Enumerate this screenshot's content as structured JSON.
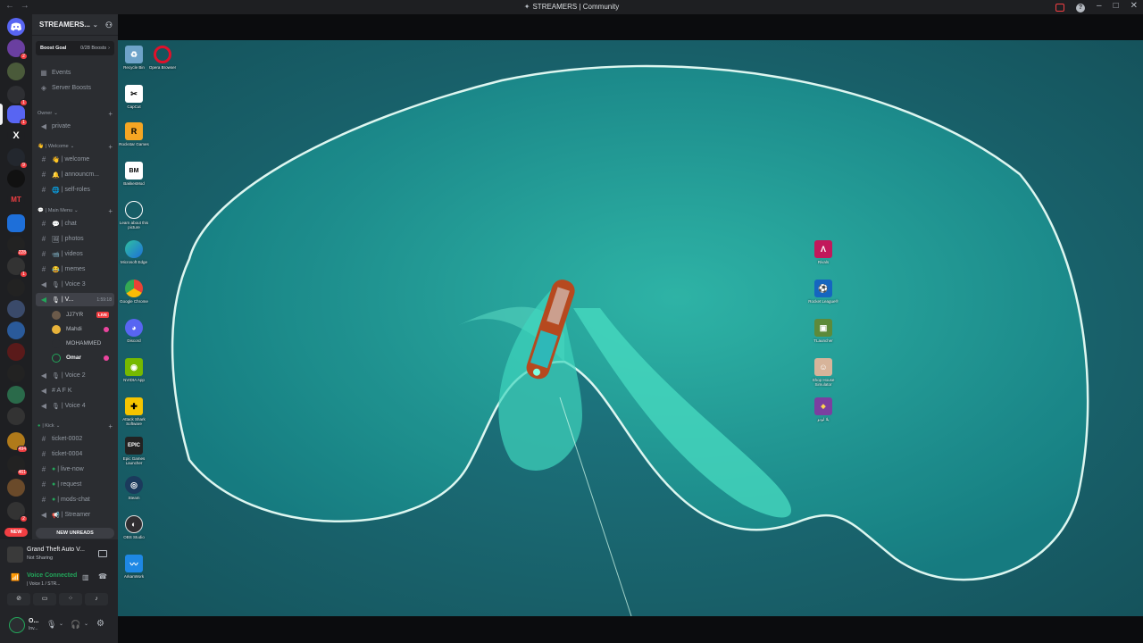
{
  "window": {
    "title": "STREAMERS | Community",
    "back": "←",
    "forward": "→",
    "minimize": "–",
    "maximize": "□",
    "close": "✕"
  },
  "server": {
    "name": "STREAMERS...",
    "boost_goal": "Boost Goal",
    "boost_count": "0/28 Boosts"
  },
  "nav": {
    "events": "Events",
    "server_boosts": "Server Boosts"
  },
  "categories": {
    "owner": "Owner",
    "welcome": "| Welcome",
    "main_menu": "| Main Menu",
    "kick": "| Kick"
  },
  "channels": {
    "private": "private",
    "welcome": "| welcome",
    "announcements": "| announcm...",
    "self_roles": "| self-roles",
    "chat": "| chat",
    "photos": "| photos",
    "videos": "| videos",
    "memes": "| memes",
    "voice3": "| Voice 3",
    "voice1": "| V...",
    "voice1_timer": "1:59:18",
    "voice2": "| Voice 2",
    "afk": "# A F K",
    "voice4": "| Voice 4",
    "ticket2": "ticket-0002",
    "ticket4": "ticket-0004",
    "live_now": "| live-now",
    "request": "| request",
    "mods_chat": "| mods-chat",
    "streamer": "| Streamer"
  },
  "voice_users": [
    {
      "name": "JJ7YR",
      "tag": "LIVE"
    },
    {
      "name": "Mahdi"
    },
    {
      "name": "MOHAMMED"
    },
    {
      "name": "Omar"
    }
  ],
  "new_unreads": "NEW UNREADS",
  "activity": {
    "game": "Grand Theft Auto V...",
    "status": "Not Sharing"
  },
  "voice": {
    "status": "Voice Connected",
    "channel": "| Voice 1 / STR..."
  },
  "user": {
    "name": "O...",
    "status": "Inv..."
  },
  "guild_badges": [
    "2",
    "1",
    "1",
    "9",
    "228",
    "1",
    "494",
    "461",
    "2"
  ],
  "guild_new": "NEW",
  "desktop_icons_left": [
    "Recycle Bin",
    "Opera Browser",
    "CapCut",
    "Rockstar Games",
    "BakkesMod",
    "Learn about this picture",
    "Microsoft Edge",
    "Google Chrome",
    "Discord",
    "NVIDIA App",
    "Attack Shark Software",
    "Epic Games Launcher",
    "Steam",
    "OBS Studio",
    "ArkanWork"
  ],
  "desktop_icons_right": [
    "Rivals",
    "Rocket League®",
    "TLauncher",
    "Shop House Simulator",
    "يلا لودو"
  ],
  "colors": {
    "accent": "#5865f2",
    "green": "#23a55a",
    "red": "#f23f43",
    "water": "#1f6a74"
  }
}
